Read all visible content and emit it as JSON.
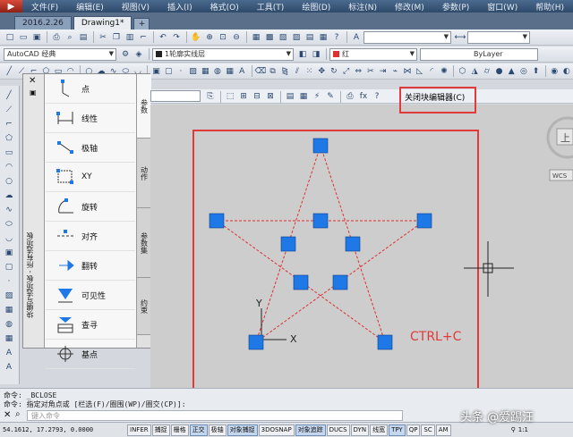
{
  "menu": {
    "items": [
      "文件(F)",
      "编辑(E)",
      "视图(V)",
      "插入(I)",
      "格式(O)",
      "工具(T)",
      "绘图(D)",
      "标注(N)",
      "修改(M)",
      "参数(P)",
      "窗口(W)",
      "帮助(H)"
    ]
  },
  "tabs": [
    {
      "label": "2016.2.26",
      "active": false
    },
    {
      "label": "Drawing1*",
      "active": true
    }
  ],
  "toolbar": {
    "workspace": "AutoCAD 经典",
    "layer": "1轮廓实线层",
    "color": "红",
    "linetype": "ByLayer",
    "color_hex": "#e03030"
  },
  "palette": {
    "title": "块编写选项板 - 所有选项板",
    "items": [
      {
        "label": "点",
        "icon": "point-parameter-icon"
      },
      {
        "label": "线性",
        "icon": "linear-parameter-icon"
      },
      {
        "label": "极轴",
        "icon": "polar-parameter-icon"
      },
      {
        "label": "XY",
        "icon": "xy-parameter-icon"
      },
      {
        "label": "旋转",
        "icon": "rotation-parameter-icon"
      },
      {
        "label": "对齐",
        "icon": "alignment-parameter-icon"
      },
      {
        "label": "翻转",
        "icon": "flip-parameter-icon"
      },
      {
        "label": "可见性",
        "icon": "visibility-parameter-icon"
      },
      {
        "label": "查寻",
        "icon": "lookup-parameter-icon"
      },
      {
        "label": "基点",
        "icon": "basepoint-parameter-icon"
      }
    ],
    "tabs": [
      "参数",
      "动作",
      "参数集",
      "约束"
    ]
  },
  "block_editor": {
    "close_label": "关闭块编辑器(C)",
    "highlight_color": "#e03a3a"
  },
  "canvas": {
    "annotation": "CTRL+C",
    "annotation_color": "#e03a3a",
    "grip_color": "#1e78e6",
    "line_color": "#e03030",
    "viewcube": {
      "label": "上",
      "wcs": "WCS"
    },
    "ucs": {
      "y": "Y",
      "x": "X"
    }
  },
  "command": {
    "history": [
      "命令: _BCLOSE",
      "命令: 指定对角点或 [栏选(F)/圈围(WP)/圈交(CP)]:"
    ],
    "placeholder": "键入命令"
  },
  "status": {
    "coords": "54.1612, 17.2793, 0.0000",
    "toggles": [
      {
        "label": "INFER",
        "on": false
      },
      {
        "label": "捕捉",
        "on": false
      },
      {
        "label": "栅格",
        "on": false
      },
      {
        "label": "正交",
        "on": true
      },
      {
        "label": "极轴",
        "on": false
      },
      {
        "label": "对象捕捉",
        "on": true
      },
      {
        "label": "3DOSNAP",
        "on": false
      },
      {
        "label": "对象追踪",
        "on": true
      },
      {
        "label": "DUCS",
        "on": false
      },
      {
        "label": "DYN",
        "on": false
      },
      {
        "label": "线宽",
        "on": false
      },
      {
        "label": "TPY",
        "on": true
      },
      {
        "label": "QP",
        "on": false
      },
      {
        "label": "SC",
        "on": false
      },
      {
        "label": "AM",
        "on": false
      }
    ],
    "scale": "1:1"
  },
  "watermark": "头条 @爱踢汪"
}
